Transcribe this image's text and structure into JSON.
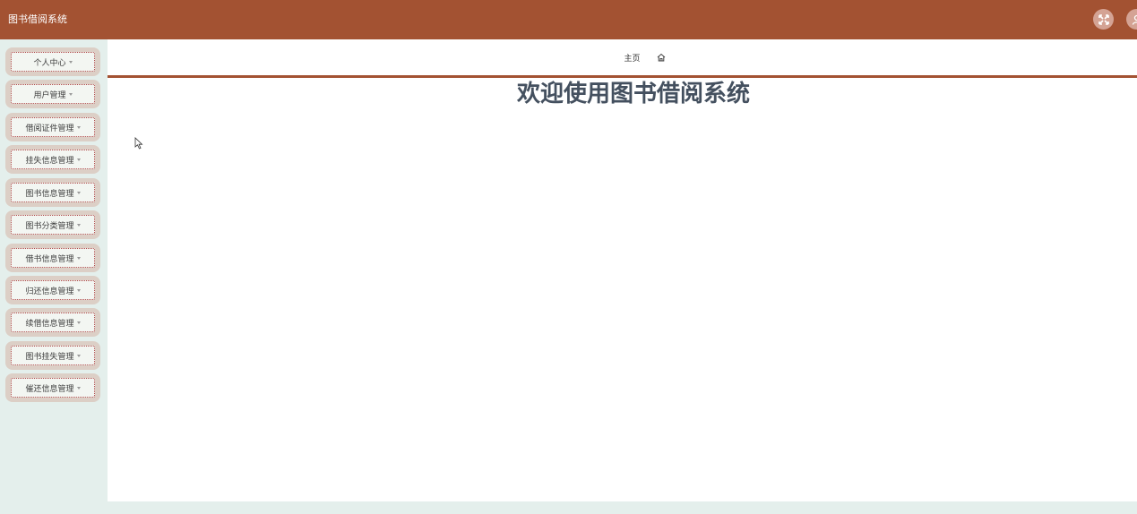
{
  "header": {
    "title": "图书借阅系统",
    "icons": {
      "fullscreen": "fullscreen-icon",
      "user": "user-icon"
    }
  },
  "sidebar": {
    "items": [
      {
        "label": "个人中心"
      },
      {
        "label": "用户管理"
      },
      {
        "label": "借阅证件管理"
      },
      {
        "label": "挂失信息管理"
      },
      {
        "label": "图书信息管理"
      },
      {
        "label": "图书分类管理"
      },
      {
        "label": "借书信息管理"
      },
      {
        "label": "归还信息管理"
      },
      {
        "label": "续借信息管理"
      },
      {
        "label": "图书挂失管理"
      },
      {
        "label": "催还信息管理"
      }
    ]
  },
  "breadcrumb": {
    "label": "主页",
    "icon": "home-icon"
  },
  "main": {
    "welcome": "欢迎使用图书借阅系统"
  },
  "colors": {
    "header": "#a35232",
    "sidebar_bg": "#e4efec",
    "menu_outer": "#dccfc6",
    "menu_inner": "#f3f6f2",
    "welcome_text": "#44505f"
  }
}
